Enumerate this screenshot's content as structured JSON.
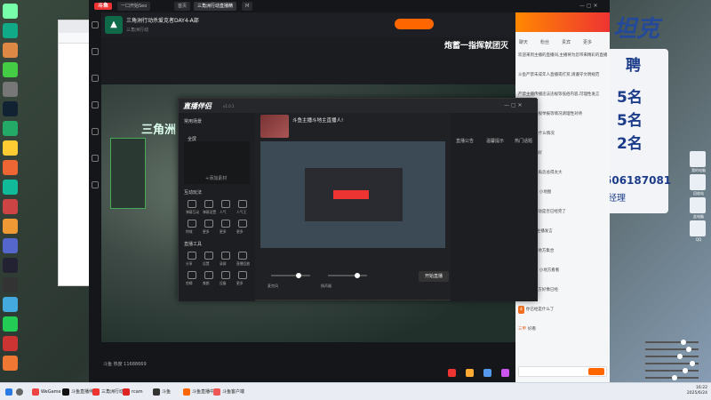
{
  "background": {
    "promo_title": "坦克",
    "card_lines": [
      "聘",
      "5名",
      "5名",
      "2名"
    ],
    "phone": "506187081",
    "manager": "经理"
  },
  "desktop_icons": [
    {
      "name": "user-icon",
      "color": "#7fa"
    },
    {
      "name": "edge-icon",
      "color": "#1a8"
    },
    {
      "name": "app-icon",
      "color": "#d84"
    },
    {
      "name": "security-icon",
      "color": "#4c4"
    },
    {
      "name": "app-icon",
      "color": "#777"
    },
    {
      "name": "steam-icon",
      "color": "#123"
    },
    {
      "name": "game-icon",
      "color": "#2a6"
    },
    {
      "name": "app-icon",
      "color": "#fc3"
    },
    {
      "name": "app-icon",
      "color": "#e63"
    },
    {
      "name": "store-icon",
      "color": "#1b9"
    },
    {
      "name": "app-icon",
      "color": "#c44"
    },
    {
      "name": "app-icon",
      "color": "#e93"
    },
    {
      "name": "app-icon",
      "color": "#56c"
    },
    {
      "name": "qq-icon",
      "color": "#223"
    },
    {
      "name": "game-icon",
      "color": "#333"
    },
    {
      "name": "app-icon",
      "color": "#4ad"
    },
    {
      "name": "wechat-icon",
      "color": "#2c5"
    },
    {
      "name": "app-icon",
      "color": "#c33"
    },
    {
      "name": "app-icon",
      "color": "#e73"
    }
  ],
  "stream_window": {
    "logo": "斗鱼",
    "tabs": [
      "一口开始Seo",
      "首页",
      "三角洲行动直播精",
      "M"
    ],
    "room_title": "三角洲行动杀爱克者DAY4-A部",
    "room_sub": "三角洲行动",
    "banner": "炮蓄一指挥就团灭",
    "game_title": "三角洲",
    "viewers": "斗鱼 热度 11688669"
  },
  "chat": {
    "tabs": [
      "聊天",
      "粉丝",
      "贵宾",
      "更多"
    ],
    "lines": [
      {
        "badge": "",
        "name": "",
        "text": "欢迎来到主播的直播间,主播将为您带来精彩的直播内容"
      },
      {
        "badge": "",
        "name": "",
        "text": "斗鱼严禁未成年人直播或打赏,请遵守文明规范"
      },
      {
        "badge": "",
        "name": "",
        "text": "严禁主播传播违法违规等低俗内容,可理性发言"
      },
      {
        "badge": "",
        "name": "",
        "text": "如遇到非正规举报等情况请理性对待"
      },
      {
        "badge": "12",
        "name": "奶茶",
        "text": "什么情况"
      },
      {
        "badge": "8",
        "name": "",
        "text": "快乐就好"
      },
      {
        "badge": "",
        "name": "",
        "text": "不能让唐僧再念总得太大"
      },
      {
        "badge": "5",
        "name": "",
        "text": "小地方 小地图"
      },
      {
        "badge": "7",
        "name": "",
        "text": "这次行动是否已经完了"
      },
      {
        "badge": "10",
        "name": "",
        "text": "这是主播发言"
      },
      {
        "badge": "3",
        "name": "",
        "text": "要这个地方集合"
      },
      {
        "badge": "6",
        "name": "",
        "text": "小地图 小地方看看"
      },
      {
        "badge": "9",
        "name": "",
        "text": "这个地方好像已经"
      },
      {
        "badge": "4",
        "name": "",
        "text": "你已经是什么了"
      },
      {
        "badge": "",
        "name": "三甲",
        "text": "好看"
      }
    ]
  },
  "assistant": {
    "logo": "直播伴侣",
    "version": "v1.0.1",
    "scene_label": "常用场景",
    "scene_item": "全屏",
    "add_source": "+添加素材",
    "section_interact": "互动玩法",
    "interact_items": [
      "弹幕互动",
      "弹幕设置",
      "人气",
      "人气王",
      "特效",
      "更多",
      "更多",
      "更多"
    ],
    "section_tools": "直播工具",
    "tool_items": [
      "分享",
      "设置",
      "录屏",
      "直播回放",
      "剪辑",
      "美颜",
      "设备",
      "更多"
    ],
    "stream_title": "斗鱼主播斗地主直播人!",
    "right_labels": [
      "直播公告",
      "温馨提示",
      "热门话题"
    ],
    "start": "开始直播",
    "audio_labels": [
      "麦克风",
      "扬声器"
    ]
  },
  "right_widgets": [
    "我的电脑",
    "回收站",
    "此电脑",
    "QQ"
  ],
  "taskbar": {
    "items": [
      "WeGame",
      "斗鱼直播伴侣",
      "三角洲行动",
      "rcam",
      "斗鱼",
      "斗鱼直播中心",
      "斗鱼客户端"
    ],
    "time": "16:22",
    "date": "2025/6/24"
  }
}
